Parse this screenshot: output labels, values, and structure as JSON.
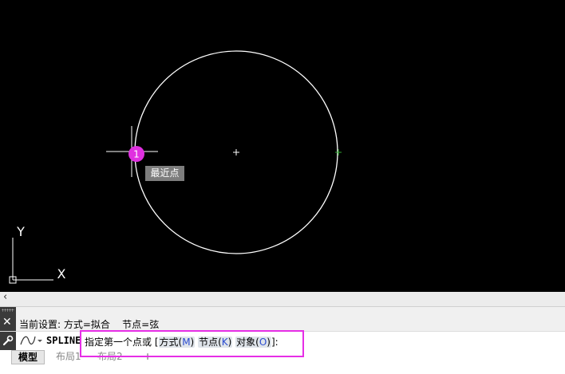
{
  "canvas": {
    "background": "#000000",
    "osnap_tooltip": "最近点",
    "snap_marker_label": "1",
    "snap_marker_color": "#e030e0",
    "ucs_x_label": "X",
    "ucs_y_label": "Y"
  },
  "command_history": {
    "text": "当前设置: 方式=拟合    节点=弦"
  },
  "command_line": {
    "command_name": "SPLINE",
    "prompt_text": "指定第一个点或 [",
    "options": [
      {
        "label": "方式(",
        "key": "M",
        "close": ")"
      },
      {
        "label": "节点(",
        "key": "K",
        "close": ")"
      },
      {
        "label": "对象(",
        "key": "O",
        "close": ")"
      }
    ],
    "prompt_end": "]:",
    "highlight_color": "#e62ee6"
  },
  "tabs": [
    {
      "label": "模型",
      "active": true
    },
    {
      "label": "布局1",
      "active": false
    },
    {
      "label": "布局2",
      "active": false
    },
    {
      "label": "+",
      "active": false
    }
  ],
  "icons": {
    "scroll_left": "‹",
    "close": "✕",
    "tool": "wrench-icon",
    "recent_command": "spline-icon"
  }
}
